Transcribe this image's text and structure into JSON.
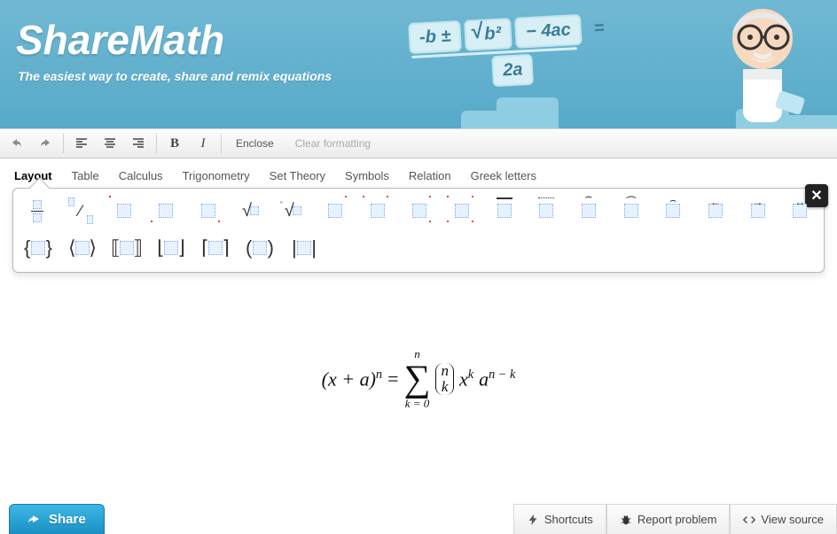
{
  "brand": {
    "title": "ShareMath",
    "tagline": "The easiest way to create, share and remix equations"
  },
  "banner_formula": {
    "num_l": "-b ±",
    "rad": "b²",
    "num_r": "− 4ac",
    "eq": "=",
    "den": "2a"
  },
  "toolbar": {
    "enclose": "Enclose",
    "clear": "Clear formatting"
  },
  "tabs": [
    "Layout",
    "Table",
    "Calculus",
    "Trigonometry",
    "Set Theory",
    "Symbols",
    "Relation",
    "Greek letters"
  ],
  "active_tab": 0,
  "palette_close": "✕",
  "equation": {
    "lhs_base": "(x + a)",
    "lhs_exp": "n",
    "eq": "=",
    "sum_upper": "n",
    "sum_lower": "k = 0",
    "binom_top": "n",
    "binom_bot": "k",
    "term1_base": "x",
    "term1_exp": "k",
    "term2_base": "a",
    "term2_exp": "n − k"
  },
  "footer": {
    "share": "Share",
    "shortcuts": "Shortcuts",
    "report": "Report problem",
    "source": "View source"
  }
}
